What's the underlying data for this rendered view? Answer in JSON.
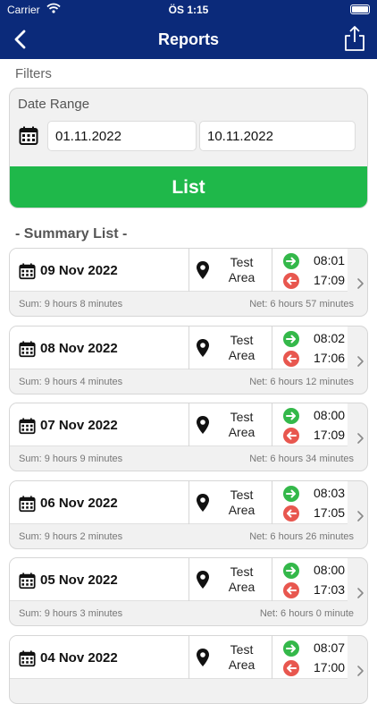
{
  "status": {
    "carrier": "Carrier",
    "time": "ÖS 1:15"
  },
  "nav": {
    "title": "Reports",
    "back_icon": "chevron-left-icon",
    "share_icon": "share-icon"
  },
  "filters": {
    "label": "Filters",
    "date_range_label": "Date Range",
    "start_date": "01.11.2022",
    "end_date": "10.11.2022",
    "list_button": "List"
  },
  "summary": {
    "title": "- Summary List -",
    "entries": [
      {
        "date": "09 Nov 2022",
        "location_line1": "Test",
        "location_line2": "Area",
        "in_time": "08:01",
        "out_time": "17:09",
        "sum": "Sum: 9 hours 8 minutes",
        "net": "Net: 6 hours 57 minutes"
      },
      {
        "date": "08 Nov 2022",
        "location_line1": "Test",
        "location_line2": "Area",
        "in_time": "08:02",
        "out_time": "17:06",
        "sum": "Sum: 9 hours 4 minutes",
        "net": "Net: 6 hours 12 minutes"
      },
      {
        "date": "07 Nov 2022",
        "location_line1": "Test",
        "location_line2": "Area",
        "in_time": "08:00",
        "out_time": "17:09",
        "sum": "Sum: 9 hours 9 minutes",
        "net": "Net: 6 hours 34 minutes"
      },
      {
        "date": "06 Nov 2022",
        "location_line1": "Test",
        "location_line2": "Area",
        "in_time": "08:03",
        "out_time": "17:05",
        "sum": "Sum: 9 hours 2 minutes",
        "net": "Net: 6 hours 26 minutes"
      },
      {
        "date": "05 Nov 2022",
        "location_line1": "Test",
        "location_line2": "Area",
        "in_time": "08:00",
        "out_time": "17:03",
        "sum": "Sum: 9 hours 3 minutes",
        "net": "Net: 6 hours 0 minute"
      },
      {
        "date": "04 Nov 2022",
        "location_line1": "Test",
        "location_line2": "Area",
        "in_time": "08:07",
        "out_time": "17:00",
        "sum": "",
        "net": ""
      }
    ]
  },
  "colors": {
    "navbar": "#0b2a7a",
    "list_button": "#1fb84a",
    "check_in": "#34b84a",
    "check_out": "#e8574f"
  }
}
